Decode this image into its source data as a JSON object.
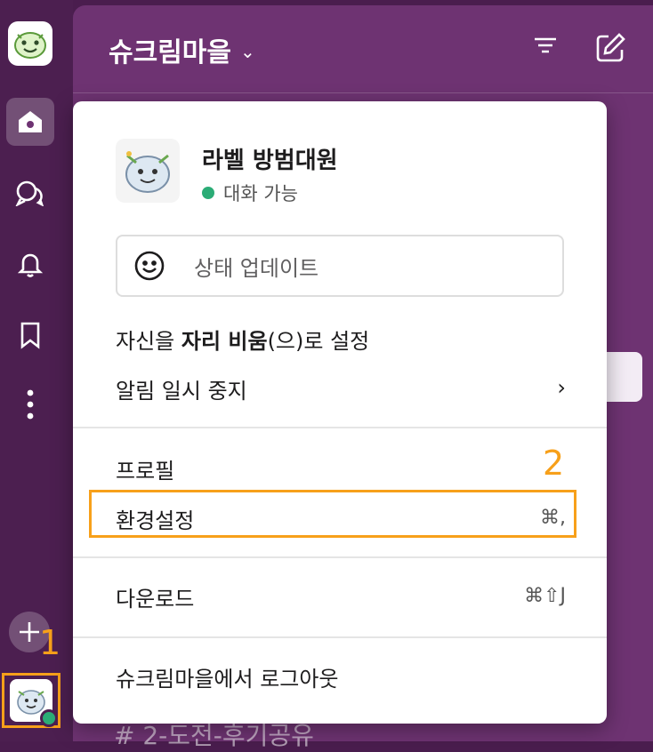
{
  "workspace": {
    "name": "슈크림마을",
    "channel_partial": "#  2-도전-후기공유"
  },
  "menu": {
    "profile_name": "라벨 방범대원",
    "profile_status": "대화 가능",
    "status_placeholder": "상태 업데이트",
    "away_prefix": "자신을 ",
    "away_bold": "자리 비움",
    "away_suffix": "(으)로 설정",
    "pause_notifications": "알림 일시 중지",
    "pause_chevron": "›",
    "profile": "프로필",
    "preferences": "환경설정",
    "preferences_shortcut": "⌘,",
    "downloads": "다운로드",
    "downloads_shortcut": "⌘⇧J",
    "sign_out": "슈크림마을에서 로그아웃"
  },
  "annotations": {
    "step1": "1",
    "step2": "2"
  },
  "icons": {
    "rail": [
      "home-icon",
      "dms-icon",
      "bell-icon",
      "bookmark-icon",
      "more-icon"
    ],
    "header": [
      "filter-icon",
      "compose-icon"
    ]
  },
  "colors": {
    "rail_bg": "#4c1f50",
    "sidebar_bg": "#6e3372",
    "presence_green": "#2bac76",
    "annotation_orange": "#f7a01a"
  }
}
